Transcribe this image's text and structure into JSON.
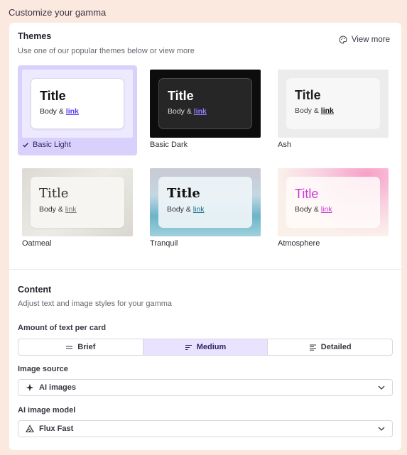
{
  "page": {
    "title": "Customize your gamma"
  },
  "themes": {
    "title": "Themes",
    "subtitle": "Use one of our popular themes below or view more",
    "view_more_label": "View more",
    "sample": {
      "title": "Title",
      "body": "Body &",
      "link": "link"
    },
    "items": [
      {
        "name": "Basic Light",
        "selected": true
      },
      {
        "name": "Basic Dark",
        "selected": false
      },
      {
        "name": "Ash",
        "selected": false
      },
      {
        "name": "Oatmeal",
        "selected": false
      },
      {
        "name": "Tranquil",
        "selected": false
      },
      {
        "name": "Atmosphere",
        "selected": false
      }
    ]
  },
  "content": {
    "title": "Content",
    "subtitle": "Adjust text and image styles for your gamma",
    "text_amount": {
      "label": "Amount of text per card",
      "options": [
        "Brief",
        "Medium",
        "Detailed"
      ],
      "selected": "Medium"
    },
    "image_source": {
      "label": "Image source",
      "value": "AI images",
      "icon": "sparkle-icon"
    },
    "image_model": {
      "label": "AI image model",
      "value": "Flux Fast",
      "icon": "model-icon"
    }
  },
  "colors": {
    "accent": "#5b3cf0",
    "selected_bg": "#d9d0fb",
    "page_bg": "#fbe9e0"
  }
}
